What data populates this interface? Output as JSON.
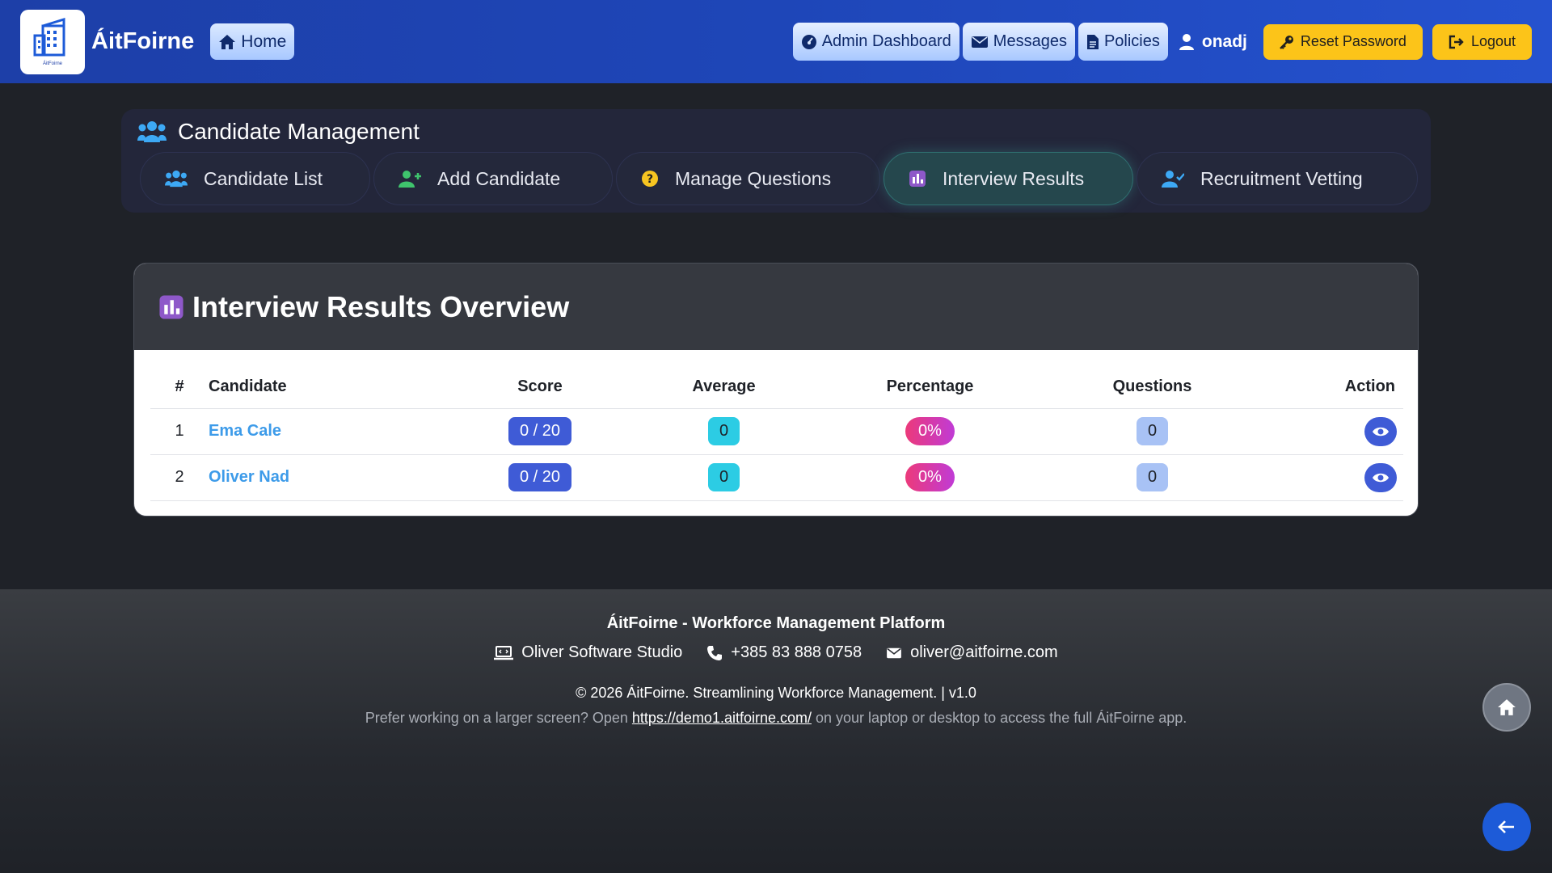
{
  "header": {
    "logo_small_text": "ÁitFoirne",
    "brand": "ÁitFoirne",
    "home_label": "Home",
    "nav": [
      {
        "label": "Admin Dashboard",
        "icon": "gauge-icon"
      },
      {
        "label": "Messages",
        "icon": "envelope-icon"
      },
      {
        "label": "Policies",
        "icon": "document-icon"
      }
    ],
    "username": "onadj",
    "reset_password_label": "Reset Password",
    "logout_label": "Logout"
  },
  "panel": {
    "title": "Candidate Management",
    "tabs": [
      {
        "label": "Candidate List",
        "icon": "users-icon"
      },
      {
        "label": "Add Candidate",
        "icon": "user-plus-icon"
      },
      {
        "label": "Manage Questions",
        "icon": "question-icon"
      },
      {
        "label": "Interview Results",
        "icon": "chart-icon",
        "active": true
      },
      {
        "label": "Recruitment Vetting",
        "icon": "user-check-icon"
      }
    ]
  },
  "card": {
    "title": "Interview Results Overview",
    "columns": [
      "#",
      "Candidate",
      "Score",
      "Average",
      "Percentage",
      "Questions",
      "Action"
    ],
    "rows": [
      {
        "index": "1",
        "candidate": "Ema Cale",
        "score": "0 / 20",
        "average": "0",
        "percentage": "0%",
        "questions": "0"
      },
      {
        "index": "2",
        "candidate": "Oliver Nad",
        "score": "0 / 20",
        "average": "0",
        "percentage": "0%",
        "questions": "0"
      }
    ]
  },
  "footer": {
    "title": "ÁitFoirne - Workforce Management Platform",
    "company": "Oliver Software Studio",
    "phone": "+385 83 888 0758",
    "email": "oliver@aitfoirne.com",
    "copyright": "© 2026 ÁitFoirne. Streamlining Workforce Management. | v1.0",
    "note_prefix": "Prefer working on a larger screen? Open",
    "note_link": "https://demo1.aitfoirne.com/",
    "note_suffix": "on your laptop or desktop to access the full ÁitFoirne app."
  },
  "colors": {
    "header_blue": "#1e46b8",
    "accent_yellow": "#fcc419",
    "link_blue": "#3d9be9",
    "score_pill": "#3f5bd6",
    "average_pill": "#2ccce4",
    "questions_pill": "#a8c2f5"
  }
}
